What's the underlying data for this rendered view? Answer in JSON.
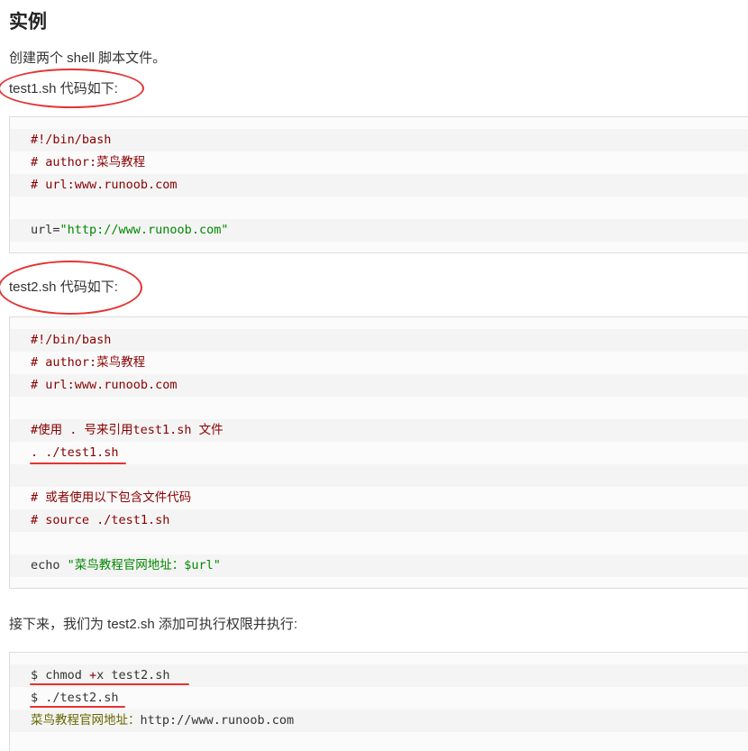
{
  "heading": "实例",
  "intro": "创建两个 shell 脚本文件。",
  "test1_label": "test1.sh 代码如下:",
  "test1_code": {
    "l1": "#!/bin/bash",
    "l2": "# author:菜鸟教程",
    "l3": "# url:www.runoob.com",
    "l5a": "url=",
    "l5b": "\"http://www.runoob.com\""
  },
  "test2_label": "test2.sh 代码如下:",
  "test2_code": {
    "l1": "#!/bin/bash",
    "l2": "# author:菜鸟教程",
    "l3": "# url:www.runoob.com",
    "l5": "#使用 . 号来引用test1.sh 文件",
    "l6": ". ./test1.sh",
    "l8": "# 或者使用以下包含文件代码",
    "l9": "# source ./test1.sh",
    "l11a": "echo ",
    "l11b": "\"菜鸟教程官网地址：$url\""
  },
  "next_text": "接下来，我们为 test2.sh 添加可执行权限并执行:",
  "terminal": {
    "l1a": "$ chmod ",
    "l1b": "+",
    "l1c": "x test2.sh",
    "l2": "$ ./test2.sh",
    "l3a": "菜鸟教程官网地址：",
    "l3b": "http://www.runoob.com"
  },
  "colors": {
    "annotation": "#e53333",
    "comment": "#880000",
    "string": "#008800",
    "output": "#666600"
  }
}
